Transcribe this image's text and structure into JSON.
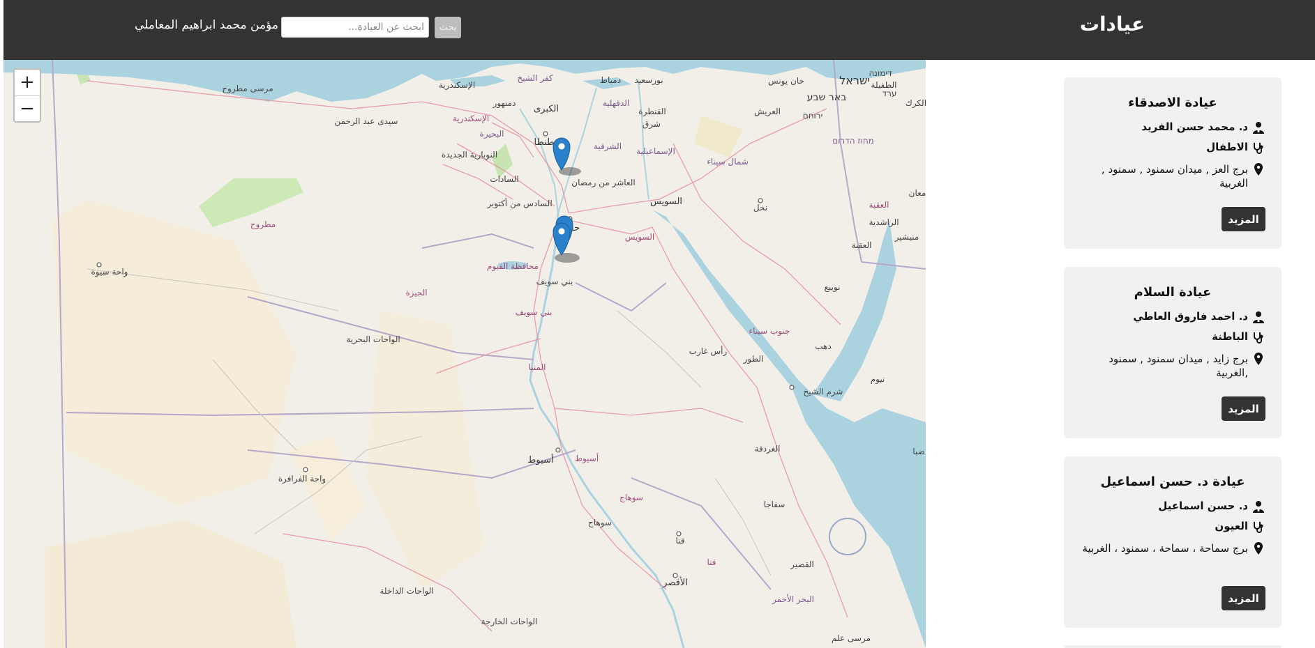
{
  "header": {
    "site_title": "عيادات",
    "user_name": "مؤمن محمد ابراهيم المعاملي",
    "search_placeholder": "ابحث عن العيادة...",
    "search_button": "بحث"
  },
  "map": {
    "zoom_in": "+",
    "zoom_out": "−",
    "labels": {
      "alexandria": "الإسكندرية",
      "alexandria2": "الإسكندرية",
      "marsa_matrouh": "مرسى مطروح",
      "sidi_abdelrahman": "سيدى عبد الرحمن",
      "kafr_sheikh": "كفر الشيخ",
      "damietta": "دمياط",
      "port_said": "بورسعيد",
      "mahalla": "الكبرى",
      "dakahlia": "الدقهلية",
      "tanta": "طنطا",
      "beheira": "البحيرة",
      "damanhour": "دمنهور",
      "sharqia": "الشرقية",
      "ismailia": "الإسماعيلية",
      "qantara": "القنطرة",
      "sharq": "شرق",
      "arish": "العريش",
      "north_sinai": "شمال سيناء",
      "sadat": "السادات",
      "nubaria": "النوبارية الجديدة",
      "sixth_october": "السادس من أكتوبر",
      "tenth_ramadan": "العاشر من رمضان",
      "helwan": "حلوان",
      "suez": "السويس",
      "suez2": "السويس",
      "matrouh": "مطروح",
      "siwa": "واحة سيوة",
      "fayoum": "محافظة الفيوم",
      "giza": "الجيزة",
      "beni_suef": "بني سويف",
      "beni_suef2": "بني سويف",
      "bahariya": "الواحات البحرية",
      "minya": "المنيا",
      "farafra": "واحة الفرافرة",
      "assiut": "أسيوط",
      "assiut2": "أسيوط",
      "sohag": "سوهاج",
      "sohag2": "سوهاج",
      "qena": "قنا",
      "qena2": "قنا",
      "luxor": "الأقصر",
      "dakhla": "الواحات الداخلة",
      "kharga": "الواحات الخارجة",
      "ras_gharib": "رأس غارب",
      "tor": "الطور",
      "south_sinai": "جنوب سيناء",
      "sharm": "شرم الشيخ",
      "dahab": "دهب",
      "nuweiba": "نويبع",
      "hurghada": "الغردقة",
      "safaga": "سفاجا",
      "quseir": "القصير",
      "red_sea": "البحر الأحمر",
      "marsa_alam": "مرسى علم",
      "nakhl": "نخل",
      "aqaba": "العقبة",
      "aqaba2": "العقبة",
      "rashidiya": "الراشدية",
      "munayshir": "منيشير",
      "maan": "معان",
      "tafila": "الطفيلة",
      "karak": "الكرك",
      "israel": "ישראל",
      "beersheba": "באר שבע",
      "yeruham": "ירוחם",
      "mitzpe": "מחוז הדרום",
      "arad": "ערד",
      "dimona": "דימונה",
      "khan_yunis": "خان يونس",
      "nuweiba_coast": "نيوم",
      "ziba": "ضبا"
    }
  },
  "clinics": [
    {
      "name": "عيادة الاصدقاء",
      "doctor": "د. محمد حسن الفريد",
      "specialty": "الاطفال",
      "address": "برج العز , ميدان سمنود , سمنود , الغربية",
      "more": "المزيد"
    },
    {
      "name": "عيادة السلام",
      "doctor": "د. احمد فاروق العاطي",
      "specialty": "الباطنة",
      "address": "برج زايد , ميدان سمنود , سمنود ,الغربية",
      "more": "المزيد"
    },
    {
      "name": "عيادة د. حسن اسماعيل",
      "doctor": "د. حسن اسماعيل",
      "specialty": "العيون",
      "address": "برج سماحة ، سماحة ، سمنود ، الغربية",
      "more": "المزيد"
    }
  ],
  "colors": {
    "header_bg": "#333333",
    "card_bg": "#f1f1f1",
    "button_bg": "#333333",
    "water": "#aad3df",
    "land": "#f1efe9",
    "marker": "#2a81cb"
  }
}
